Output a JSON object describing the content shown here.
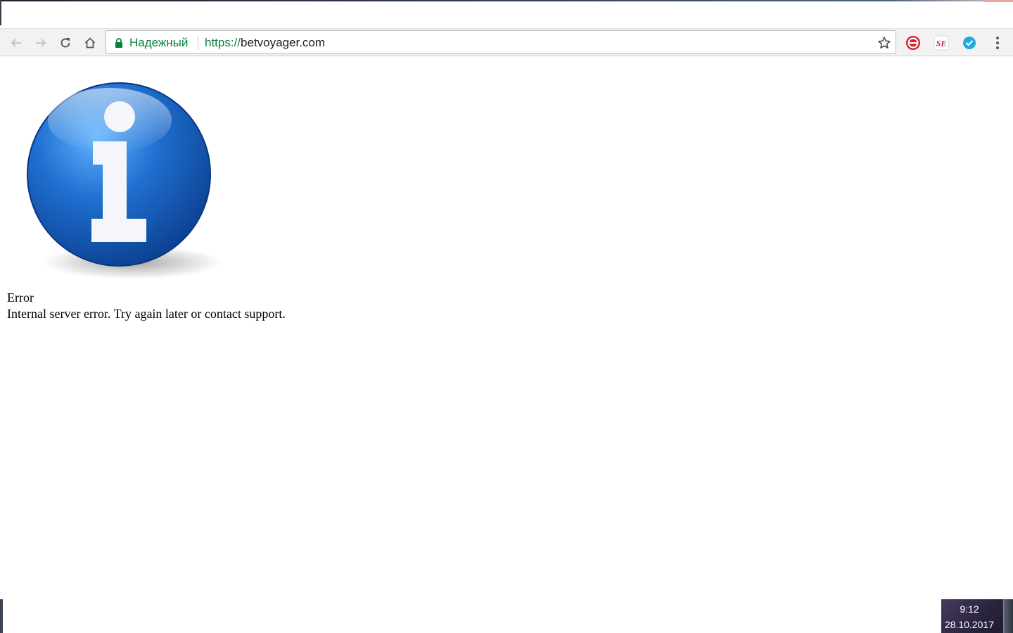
{
  "browser": {
    "security_label": "Надежный",
    "url_scheme": "https://",
    "url_host": "betvoyager.com",
    "extensions": [
      {
        "name": "red-e-extension-icon",
        "color": "#d61f2c"
      },
      {
        "name": "se-extension-icon",
        "text": "SE",
        "color": "#c2185b"
      },
      {
        "name": "checkmark-extension-icon",
        "color": "#23a9e1"
      }
    ],
    "secure_color": "#0b8043"
  },
  "page": {
    "error_title": "Error",
    "error_message": "Internal server error. Try again later or contact support.",
    "info_icon_color": "#1f6fd0"
  },
  "taskbar": {
    "time": "9:12",
    "date": "28.10.2017"
  }
}
